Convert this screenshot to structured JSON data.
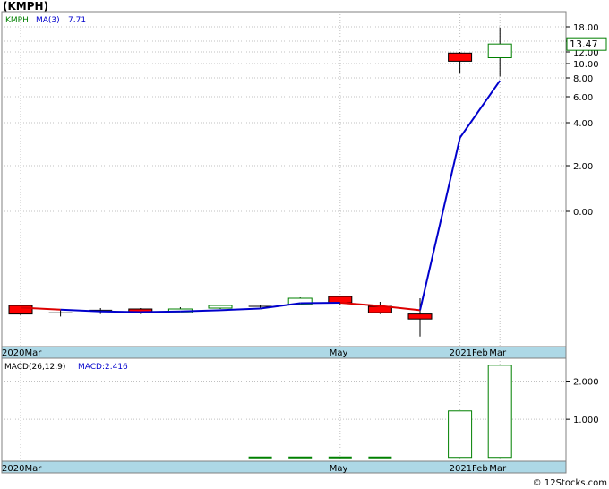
{
  "title": "(KMPH)",
  "credit": "© 12Stocks.com",
  "legend": {
    "ticker": "KMPH",
    "ma_label": "MA(3)",
    "ma_value": "7.71"
  },
  "price_box": "13.47",
  "macd_legend": {
    "label": "MACD(26,12,9)",
    "value": "MACD:2.416"
  },
  "colors": {
    "up_candle": "#008000",
    "down_candle": "#ff0000",
    "ma_line": "#0000cc",
    "axis_band": "#add8e6",
    "grid": "#c0c0c0"
  },
  "chart_data": [
    {
      "type": "candlestick",
      "ticker": "KMPH",
      "y_scale": "nonlinear",
      "y_ticks": [
        "18.00",
        "14.00",
        "12.00",
        "10.00",
        "8.00",
        "6.00",
        "4.00",
        "2.00",
        "0.00"
      ],
      "x_tick_labels": [
        "2020Mar",
        "May",
        "2021Feb",
        "Mar"
      ],
      "candles": [
        {
          "period": 1,
          "open": -5.6,
          "close": -6.4,
          "high": -5.5,
          "low": -6.5,
          "direction": "down"
        },
        {
          "period": 2,
          "open": -6.3,
          "close": -6.3,
          "high": -6.1,
          "low": -6.6,
          "direction": "flat"
        },
        {
          "period": 3,
          "open": -6.1,
          "close": -6.1,
          "high": -5.9,
          "low": -6.4,
          "direction": "flat"
        },
        {
          "period": 4,
          "open": -6.0,
          "close": -6.3,
          "high": -5.9,
          "low": -6.4,
          "direction": "down"
        },
        {
          "period": 5,
          "open": -6.3,
          "close": -6.0,
          "high": -5.8,
          "low": -6.3,
          "direction": "up"
        },
        {
          "period": 6,
          "open": -5.9,
          "close": -5.6,
          "high": -5.5,
          "low": -6.0,
          "direction": "up"
        },
        {
          "period": 7,
          "open": -5.7,
          "close": -5.7,
          "high": -5.6,
          "low": -5.9,
          "direction": "flat"
        },
        {
          "period": 8,
          "open": -5.5,
          "close": -4.8,
          "high": -4.7,
          "low": -5.5,
          "direction": "up"
        },
        {
          "period": 9,
          "open": -4.6,
          "close": -5.3,
          "high": -4.5,
          "low": -5.6,
          "direction": "down"
        },
        {
          "period": 10,
          "open": -5.7,
          "close": -6.3,
          "high": -5.2,
          "low": -6.4,
          "direction": "down"
        },
        {
          "period": 11,
          "open": -6.4,
          "close": -6.8,
          "high": -4.8,
          "low": -7.6,
          "direction": "down"
        },
        {
          "period": 12,
          "open": 11.8,
          "close": 10.4,
          "high": 12.0,
          "low": 8.6,
          "direction": "down"
        },
        {
          "period": 13,
          "open": 11.0,
          "close": 13.47,
          "high": 17.8,
          "low": 8.2,
          "direction": "up"
        }
      ],
      "moving_average": {
        "name": "MA(3)",
        "values": [
          -5.85,
          -6.05,
          -6.2,
          -6.25,
          -6.2,
          -6.1,
          -5.95,
          -5.35,
          -5.3,
          -5.65,
          -6.1,
          3.3,
          7.71
        ]
      }
    },
    {
      "type": "bar",
      "name": "MACD(26,12,9)",
      "y_ticks": [
        "2.000",
        "1.000"
      ],
      "ylim": [
        -0.1,
        2.6
      ],
      "values": [
        0,
        0,
        0,
        0,
        0,
        0,
        0.03,
        0.03,
        0.03,
        0.03,
        0,
        1.22,
        2.416
      ]
    }
  ]
}
